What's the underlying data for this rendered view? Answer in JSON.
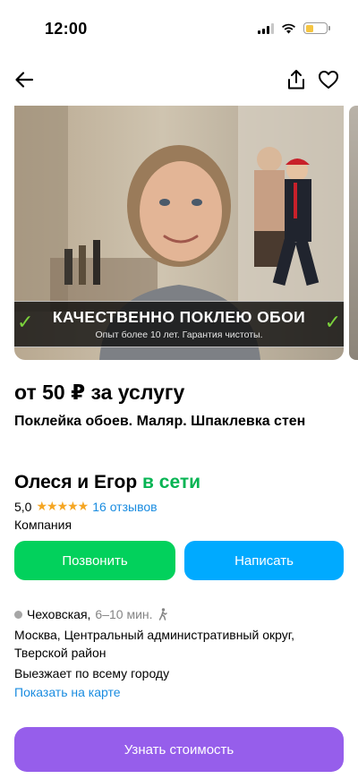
{
  "status_bar": {
    "time": "12:00",
    "battery_level": 0.4
  },
  "banner": {
    "title": "КАЧЕСТВЕННО ПОКЛЕЮ ОБОИ",
    "subtitle": "Опыт более 10 лет. Гарантия чистоты."
  },
  "listing": {
    "price": "от 50 ₽ за услугу",
    "title": "Поклейка обоев. Маляр. Шпаклевка стен"
  },
  "seller": {
    "name": "Олеся и Егор",
    "online_status": "в сети",
    "rating": "5,0",
    "stars": "★★★★★",
    "reviews": "16 отзывов",
    "type": "Компания"
  },
  "actions": {
    "call_label": "Позвонить",
    "write_label": "Написать"
  },
  "location": {
    "metro": "Чеховская,",
    "metro_time": "6–10 мин.",
    "address": "Москва, Центральный административный округ, Тверской район",
    "travel": "Выезжает по всему городу",
    "map_link": "Показать на карте"
  },
  "cta": {
    "label": "Узнать стоимость"
  },
  "colors": {
    "accent_green": "#02d15c",
    "accent_blue": "#00aaff",
    "accent_purple": "#965eeb",
    "link": "#1a8ce0",
    "star": "#f5a623"
  },
  "icons": [
    "back-arrow-icon",
    "share-icon",
    "heart-icon",
    "check-icon",
    "walking-person-icon",
    "signal-icon",
    "wifi-icon",
    "battery-icon"
  ]
}
